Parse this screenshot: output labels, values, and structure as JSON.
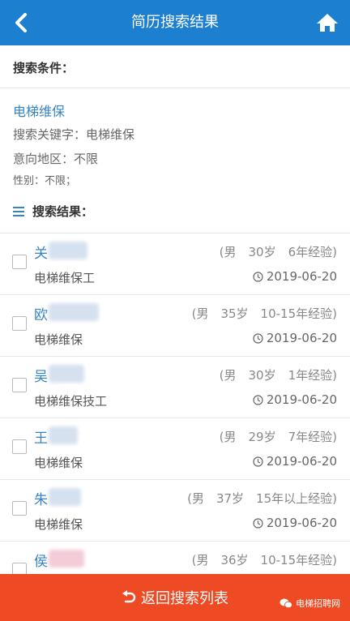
{
  "header": {
    "title": "简历搜索结果"
  },
  "conditions": {
    "label": "搜索条件：",
    "title": "电梯维保",
    "keyword": "搜索关键字：电梯维保",
    "region": "意向地区：不限",
    "gender": "性别：不限；"
  },
  "results": {
    "label": "搜索结果：",
    "items": [
      {
        "name": "关",
        "meta": "(男　30岁　6年经验)",
        "job": "电梯维保工",
        "date": "2019-06-20"
      },
      {
        "name": "欧",
        "meta": "(男　35岁　10-15年经验)",
        "job": "电梯维保",
        "date": "2019-06-20"
      },
      {
        "name": "吴",
        "meta": "(男　30岁　1年经验)",
        "job": "电梯维保技工",
        "date": "2019-06-20"
      },
      {
        "name": "王",
        "meta": "(男　29岁　7年经验)",
        "job": "电梯维保",
        "date": "2019-06-20"
      },
      {
        "name": "朱",
        "meta": "(男　37岁　15年以上经验)",
        "job": "电梯维保",
        "date": "2019-06-20"
      },
      {
        "name": "侯",
        "meta": "(男　36岁　10-15年经验)",
        "job": "",
        "date": ""
      }
    ]
  },
  "footer": {
    "button_label": "返回搜索列表"
  },
  "watermark": {
    "text": "电梯招聘网"
  },
  "icons": {
    "back": "chevron-left-icon",
    "home": "home-icon",
    "list": "list-icon",
    "clock": "clock-icon",
    "return": "return-arrow-icon",
    "watermark": "chat-bubble-icon"
  },
  "colors": {
    "header": "#1c7fd0",
    "link": "#3584c8",
    "footer": "#ee4a24"
  }
}
